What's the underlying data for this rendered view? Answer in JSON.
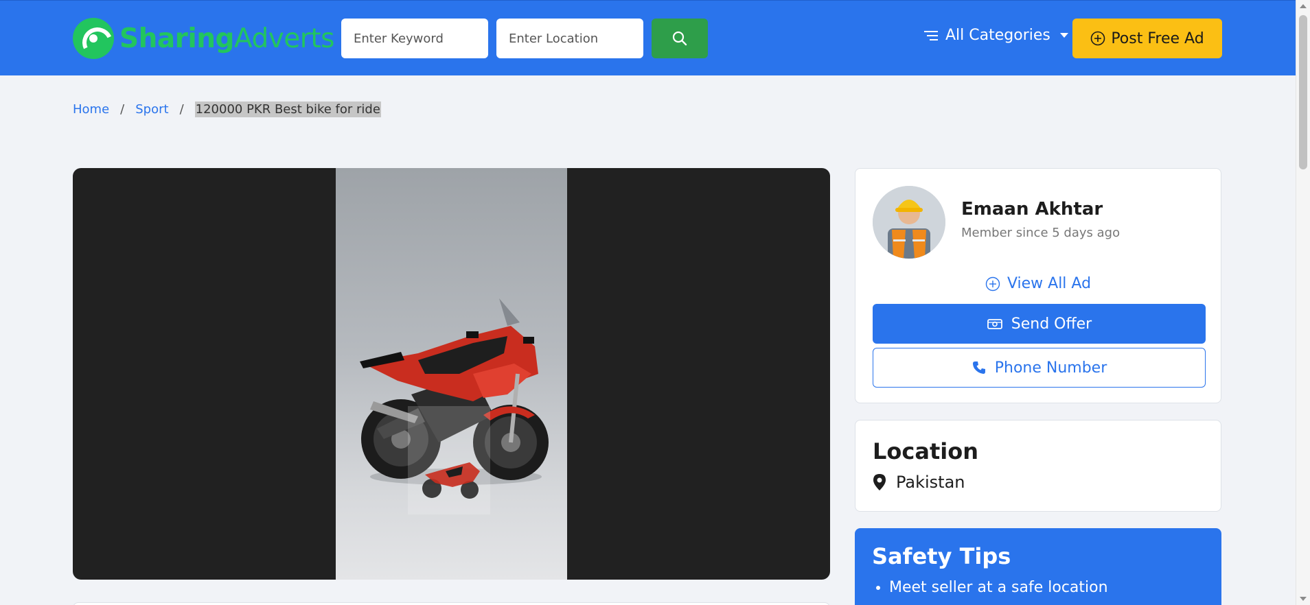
{
  "header": {
    "logo_part1": "Sharing",
    "logo_part2": "Adverts",
    "keyword_placeholder": "Enter Keyword",
    "location_placeholder": "Enter Location",
    "search_icon": "search-icon",
    "categories_label": "All Categories",
    "categories_icon": "menu-lines-icon",
    "post_ad_label": "Post Free Ad",
    "post_ad_icon": "plus-circle-icon"
  },
  "breadcrumb": {
    "items": [
      "Home",
      "Sport"
    ],
    "current": "120000 PKR Best bike for ride"
  },
  "seller": {
    "name": "Emaan Akhtar",
    "member_since": "Member since 5 days ago",
    "view_all_label": "View All Ad",
    "send_offer_label": "Send Offer",
    "phone_label": "Phone Number"
  },
  "location": {
    "title": "Location",
    "value": "Pakistan"
  },
  "safety": {
    "title": "Safety Tips",
    "tips": [
      "Meet seller at a safe location"
    ]
  },
  "colors": {
    "brand_blue": "#2a74ec",
    "logo_green": "#22c55e",
    "search_green": "#2e9e4a",
    "post_yellow": "#fbbf14"
  }
}
